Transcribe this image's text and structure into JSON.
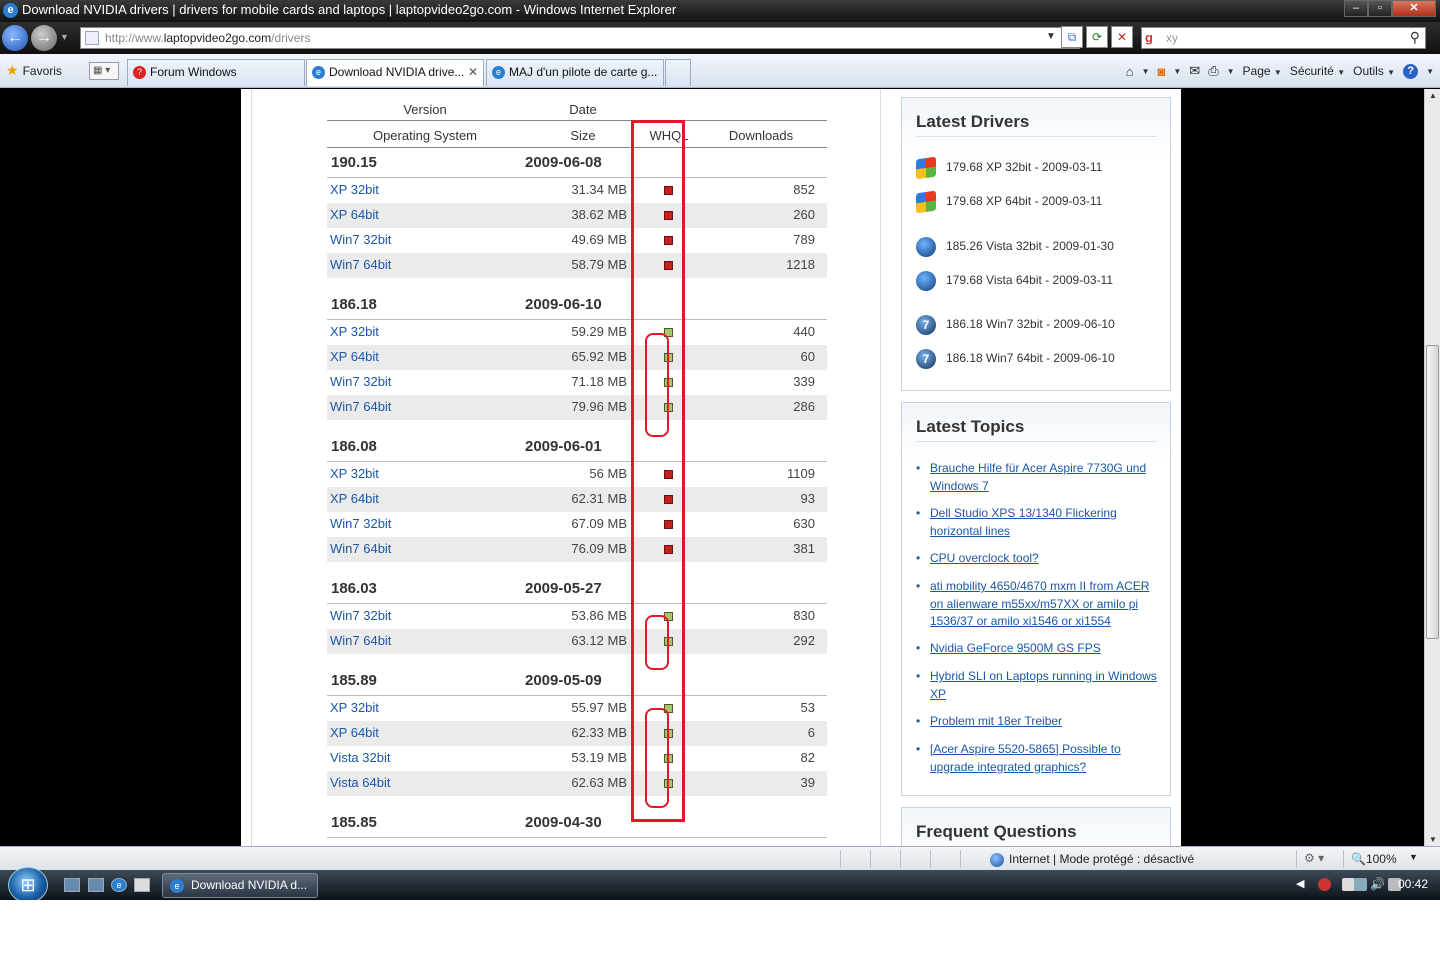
{
  "window": {
    "title": "Download NVIDIA drivers | drivers for mobile cards and laptops | laptopvideo2go.com - Windows Internet Explorer"
  },
  "address": {
    "url_prefix": "http://www.",
    "url_domain": "laptopvideo2go.com",
    "url_path": "/drivers"
  },
  "search": {
    "query": "xy"
  },
  "tabs": {
    "favorites_label": "Favoris",
    "items": [
      {
        "label": "Forum Windows"
      },
      {
        "label": "Download NVIDIA drive..."
      },
      {
        "label": "MAJ d'un pilote de carte g..."
      }
    ]
  },
  "commandbar": {
    "page_label": "Page",
    "security_label": "Sécurité",
    "tools_label": "Outils"
  },
  "table": {
    "headers": {
      "version": "Version",
      "date": "Date",
      "os": "Operating System",
      "size": "Size",
      "whql": "WHQL",
      "downloads": "Downloads"
    },
    "groups": [
      {
        "version": "190.15",
        "date": "2009-06-08",
        "rows": [
          {
            "os": "XP 32bit",
            "size": "31.34 MB",
            "whql": false,
            "downloads": "852"
          },
          {
            "os": "XP 64bit",
            "size": "38.62 MB",
            "whql": false,
            "downloads": "260"
          },
          {
            "os": "Win7 32bit",
            "size": "49.69 MB",
            "whql": false,
            "downloads": "789"
          },
          {
            "os": "Win7 64bit",
            "size": "58.79 MB",
            "whql": false,
            "downloads": "1218"
          }
        ]
      },
      {
        "version": "186.18",
        "date": "2009-06-10",
        "rows": [
          {
            "os": "XP 32bit",
            "size": "59.29 MB",
            "whql": true,
            "downloads": "440"
          },
          {
            "os": "XP 64bit",
            "size": "65.92 MB",
            "whql": true,
            "downloads": "60"
          },
          {
            "os": "Win7 32bit",
            "size": "71.18 MB",
            "whql": true,
            "downloads": "339"
          },
          {
            "os": "Win7 64bit",
            "size": "79.96 MB",
            "whql": true,
            "downloads": "286"
          }
        ]
      },
      {
        "version": "186.08",
        "date": "2009-06-01",
        "rows": [
          {
            "os": "XP 32bit",
            "size": "56 MB",
            "whql": false,
            "downloads": "1109"
          },
          {
            "os": "XP 64bit",
            "size": "62.31 MB",
            "whql": false,
            "downloads": "93"
          },
          {
            "os": "Win7 32bit",
            "size": "67.09 MB",
            "whql": false,
            "downloads": "630"
          },
          {
            "os": "Win7 64bit",
            "size": "76.09 MB",
            "whql": false,
            "downloads": "381"
          }
        ]
      },
      {
        "version": "186.03",
        "date": "2009-05-27",
        "rows": [
          {
            "os": "Win7 32bit",
            "size": "53.86 MB",
            "whql": true,
            "downloads": "830"
          },
          {
            "os": "Win7 64bit",
            "size": "63.12 MB",
            "whql": true,
            "downloads": "292"
          }
        ]
      },
      {
        "version": "185.89",
        "date": "2009-05-09",
        "rows": [
          {
            "os": "XP 32bit",
            "size": "55.97 MB",
            "whql": true,
            "downloads": "53"
          },
          {
            "os": "XP 64bit",
            "size": "62.33 MB",
            "whql": true,
            "downloads": "6"
          },
          {
            "os": "Vista 32bit",
            "size": "53.19 MB",
            "whql": true,
            "downloads": "82"
          },
          {
            "os": "Vista 64bit",
            "size": "62.63 MB",
            "whql": true,
            "downloads": "39"
          }
        ]
      },
      {
        "version": "185.85",
        "date": "2009-04-30",
        "rows": []
      }
    ]
  },
  "sidebar": {
    "latest_drivers": {
      "title": "Latest Drivers",
      "items": [
        {
          "os_icon": "windows-xp-icon",
          "label": "179.68 XP 32bit - 2009-03-11"
        },
        {
          "os_icon": "windows-xp-icon",
          "label": "179.68 XP 64bit - 2009-03-11"
        },
        {
          "os_icon": "windows-vista-icon",
          "label": "185.26 Vista 32bit - 2009-01-30"
        },
        {
          "os_icon": "windows-vista-icon",
          "label": "179.68 Vista 64bit - 2009-03-11"
        },
        {
          "os_icon": "windows-7-icon",
          "label": "186.18 Win7 32bit - 2009-06-10"
        },
        {
          "os_icon": "windows-7-icon",
          "label": "186.18 Win7 64bit - 2009-06-10"
        }
      ]
    },
    "latest_topics": {
      "title": "Latest Topics",
      "items": [
        "Brauche Hilfe für Acer Aspire 7730G und Windows 7",
        "Dell Studio XPS 13/1340 Flickering horizontal lines",
        "CPU overclock tool?",
        "ati mobility 4650/4670 mxm II from ACER on alienware m55xx/m57XX or amilo pi 1536/37 or amilo xi1546 or xi1554",
        "Nvidia GeForce 9500M GS FPS",
        "Hybrid SLI on Laptops running in Windows XP",
        "Problem mit 18er Treiber",
        "[Acer Aspire 5520-5865] Possible to upgrade integrated graphics?"
      ]
    },
    "faq": {
      "title": "Frequent Questions"
    }
  },
  "statusbar": {
    "zone": "Internet | Mode protégé : désactivé",
    "zoom": "100%"
  },
  "taskbar": {
    "task_label": "Download NVIDIA d...",
    "clock": "00:42"
  },
  "colors": {
    "link": "#1a57a8",
    "whql_no": "#c4201f",
    "whql_yes": "#a9c66a",
    "annotation": "#e0182a"
  }
}
